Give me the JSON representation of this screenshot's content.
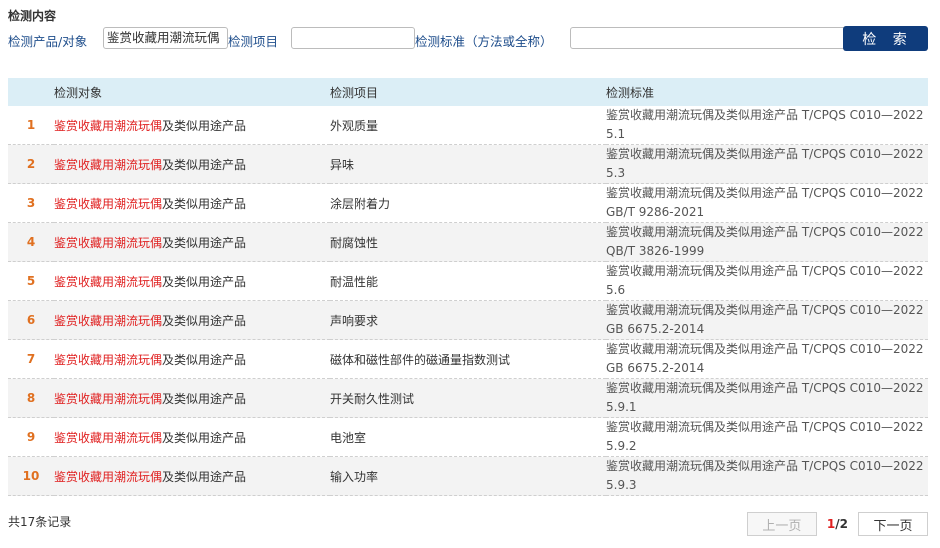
{
  "section_title": "检测内容",
  "search": {
    "product_label": "检测产品/对象",
    "product_value": "鉴赏收藏用潮流玩偶",
    "item_label": "检测项目",
    "item_value": "",
    "standard_label": "检测标准（方法或全称）",
    "standard_value": "",
    "button_label": "检 索"
  },
  "table": {
    "headers": [
      "检测对象",
      "检测项目",
      "检测标准"
    ],
    "rows": [
      {
        "idx": "1",
        "obj_hl": "鉴赏收藏用潮流玩偶",
        "obj_rest": "及类似用途产品",
        "item": "外观质量",
        "standard": "鉴赏收藏用潮流玩偶及类似用途产品 T/CPQS C010—2022\n5.1"
      },
      {
        "idx": "2",
        "obj_hl": "鉴赏收藏用潮流玩偶",
        "obj_rest": "及类似用途产品",
        "item": "异味",
        "standard": "鉴赏收藏用潮流玩偶及类似用途产品 T/CPQS C010—2022\n5.3"
      },
      {
        "idx": "3",
        "obj_hl": "鉴赏收藏用潮流玩偶",
        "obj_rest": "及类似用途产品",
        "item": "涂层附着力",
        "standard": "鉴赏收藏用潮流玩偶及类似用途产品 T/CPQS C010—2022\nGB/T 9286-2021"
      },
      {
        "idx": "4",
        "obj_hl": "鉴赏收藏用潮流玩偶",
        "obj_rest": "及类似用途产品",
        "item": "耐腐蚀性",
        "standard": "鉴赏收藏用潮流玩偶及类似用途产品 T/CPQS C010—2022\nQB/T 3826-1999"
      },
      {
        "idx": "5",
        "obj_hl": "鉴赏收藏用潮流玩偶",
        "obj_rest": "及类似用途产品",
        "item": "耐温性能",
        "standard": "鉴赏收藏用潮流玩偶及类似用途产品 T/CPQS C010—2022\n5.6"
      },
      {
        "idx": "6",
        "obj_hl": "鉴赏收藏用潮流玩偶",
        "obj_rest": "及类似用途产品",
        "item": "声响要求",
        "standard": "鉴赏收藏用潮流玩偶及类似用途产品 T/CPQS C010—2022\nGB 6675.2-2014"
      },
      {
        "idx": "7",
        "obj_hl": "鉴赏收藏用潮流玩偶",
        "obj_rest": "及类似用途产品",
        "item": "磁体和磁性部件的磁通量指数测试",
        "standard": "鉴赏收藏用潮流玩偶及类似用途产品 T/CPQS C010—2022\nGB 6675.2-2014"
      },
      {
        "idx": "8",
        "obj_hl": "鉴赏收藏用潮流玩偶",
        "obj_rest": "及类似用途产品",
        "item": "开关耐久性测试",
        "standard": "鉴赏收藏用潮流玩偶及类似用途产品 T/CPQS C010—2022\n5.9.1"
      },
      {
        "idx": "9",
        "obj_hl": "鉴赏收藏用潮流玩偶",
        "obj_rest": "及类似用途产品",
        "item": "电池室",
        "standard": "鉴赏收藏用潮流玩偶及类似用途产品 T/CPQS C010—2022\n5.9.2"
      },
      {
        "idx": "10",
        "obj_hl": "鉴赏收藏用潮流玩偶",
        "obj_rest": "及类似用途产品",
        "item": "输入功率",
        "standard": "鉴赏收藏用潮流玩偶及类似用途产品 T/CPQS C010—2022\n5.9.3"
      }
    ]
  },
  "footer": {
    "total_text": "共17条记录",
    "prev_label": "上一页",
    "current_page": "1",
    "page_separator": "/",
    "total_pages": "2",
    "next_label": "下一页"
  },
  "colors": {
    "primary_button": "#0f3c7c",
    "header_bg": "#dbeef6",
    "highlight_red": "#e02020",
    "index_orange": "#e07020",
    "label_blue": "#1f4e8c"
  }
}
